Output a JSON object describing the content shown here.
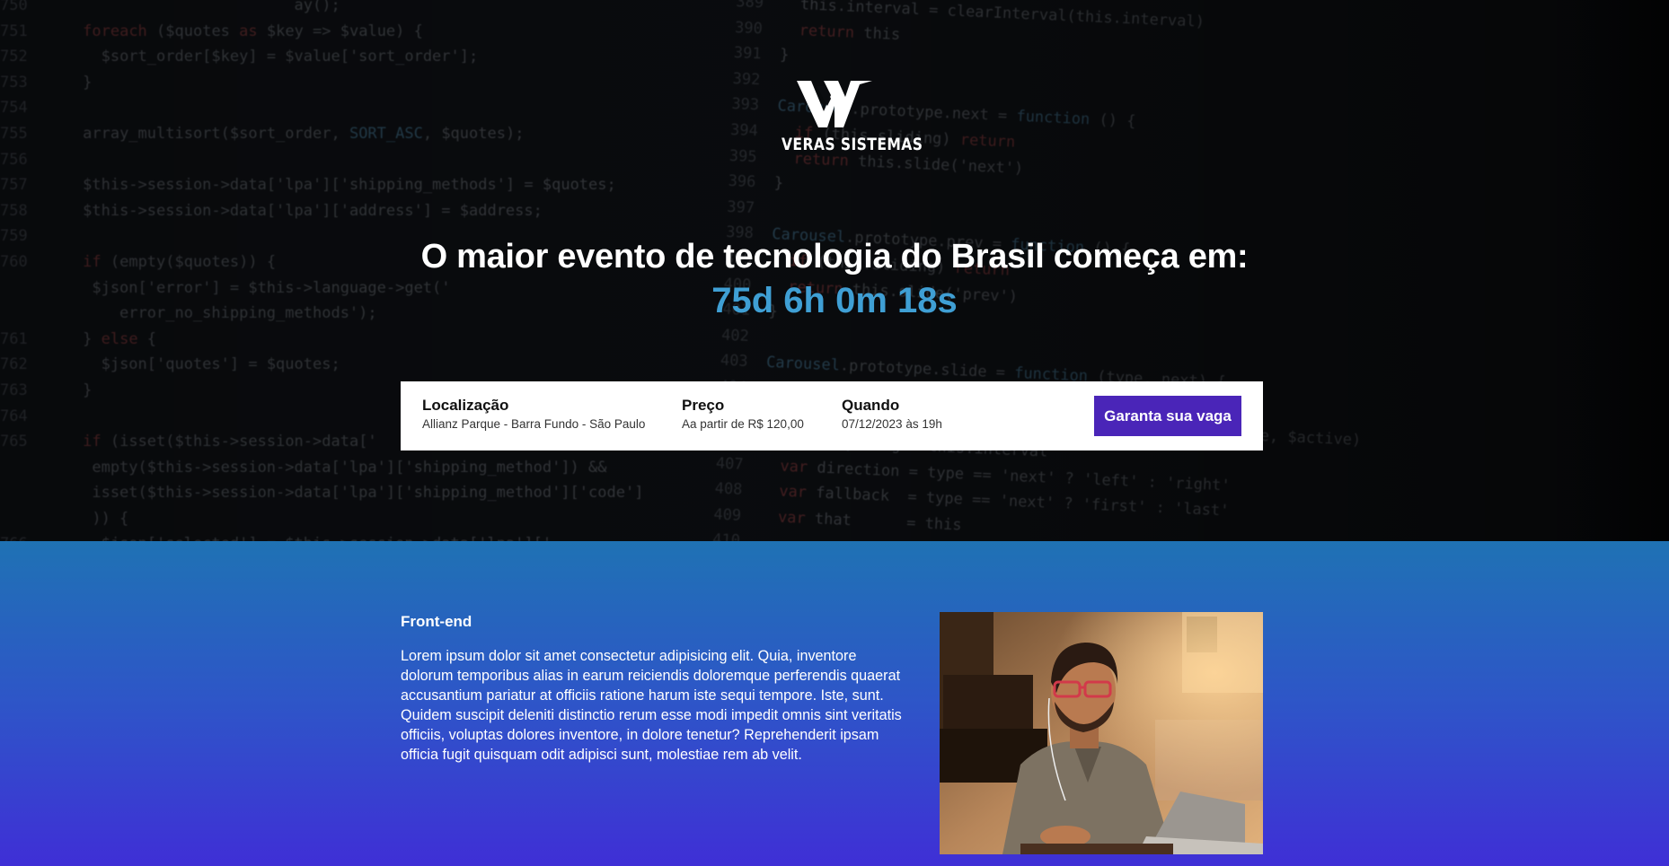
{
  "brand": {
    "name": "VERAS SISTEMAS",
    "logo_icon": "w-logo-icon"
  },
  "hero": {
    "headline": "O maior evento de tecnologia do Brasil começa em:",
    "countdown": "75d 6h 0m 18s",
    "countdown_color": "#3f9fd4"
  },
  "event_info": {
    "location_label": "Localização",
    "location_value": "Allianz Parque - Barra Fundo - São Paulo",
    "price_label": "Preço",
    "price_value": "Aa partir de R$ 120,00",
    "when_label": "Quando",
    "when_value": "07/12/2023 às 19h",
    "cta_label": "Garanta sua vaga",
    "cta_color": "#4a25b8"
  },
  "section": {
    "title": "Front-end",
    "body": "Lorem ipsum dolor sit amet consectetur adipisicing elit. Quia, inventore dolorum temporibus alias in earum reiciendis doloremque perferendis quaerat accusantium pariatur at officiis ratione harum iste sequi tempore. Iste, sunt. Quidem suscipit deleniti distinctio rerum esse modi impedit omnis sint veritatis officiis, voluptas dolores inventore, in dolore tenetur? Reprehenderit ipsam officia fugit quisquam odit adipisci sunt, molestiae rem ab velit.",
    "gradient_top": "#1f72b4",
    "gradient_bottom": "#3f2fd6"
  }
}
